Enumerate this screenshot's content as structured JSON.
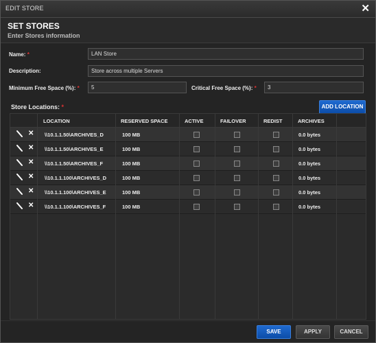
{
  "window": {
    "title": "EDIT STORE"
  },
  "header": {
    "title": "SET STORES",
    "subtitle": "Enter Stores information"
  },
  "form": {
    "name_label": "Name:",
    "name_value": "LAN Store",
    "description_label": "Description:",
    "description_value": "Store across multiple Servers",
    "min_free_label": "Minimum Free Space (%):",
    "min_free_value": "5",
    "crit_free_label": "Critical Free Space (%):",
    "crit_free_value": "3",
    "required_mark": "*"
  },
  "locations": {
    "label": "Store Locations:",
    "add_button": "ADD LOCATION",
    "columns": [
      "LOCATION",
      "RESERVED SPACE",
      "ACTIVE",
      "FAILOVER",
      "REDIST",
      "ARCHIVES"
    ],
    "rows": [
      {
        "location": "\\\\10.1.1.50\\ARCHIVES_D",
        "reserved": "100 MB",
        "active": false,
        "failover": false,
        "redist": false,
        "archives": "0.0 bytes"
      },
      {
        "location": "\\\\10.1.1.50\\ARCHIVES_E",
        "reserved": "100 MB",
        "active": false,
        "failover": false,
        "redist": false,
        "archives": "0.0 bytes"
      },
      {
        "location": "\\\\10.1.1.50\\ARCHIVES_F",
        "reserved": "100 MB",
        "active": false,
        "failover": false,
        "redist": false,
        "archives": "0.0 bytes"
      },
      {
        "location": "\\\\10.1.1.100\\ARCHIVES_D",
        "reserved": "100 MB",
        "active": false,
        "failover": false,
        "redist": false,
        "archives": "0.0 bytes"
      },
      {
        "location": "\\\\10.1.1.100\\ARCHIVES_E",
        "reserved": "100 MB",
        "active": false,
        "failover": false,
        "redist": false,
        "archives": "0.0 bytes"
      },
      {
        "location": "\\\\10.1.1.100\\ARCHIVES_F",
        "reserved": "100 MB",
        "active": false,
        "failover": false,
        "redist": false,
        "archives": "0.0 bytes"
      }
    ],
    "row_icons": {
      "edit": "pencil-icon",
      "delete": "close-icon"
    }
  },
  "footer": {
    "save": "SAVE",
    "apply": "APPLY",
    "cancel": "CANCEL"
  },
  "colors": {
    "accent": "#1a5fc4",
    "required": "#d33333",
    "background": "#242424"
  }
}
